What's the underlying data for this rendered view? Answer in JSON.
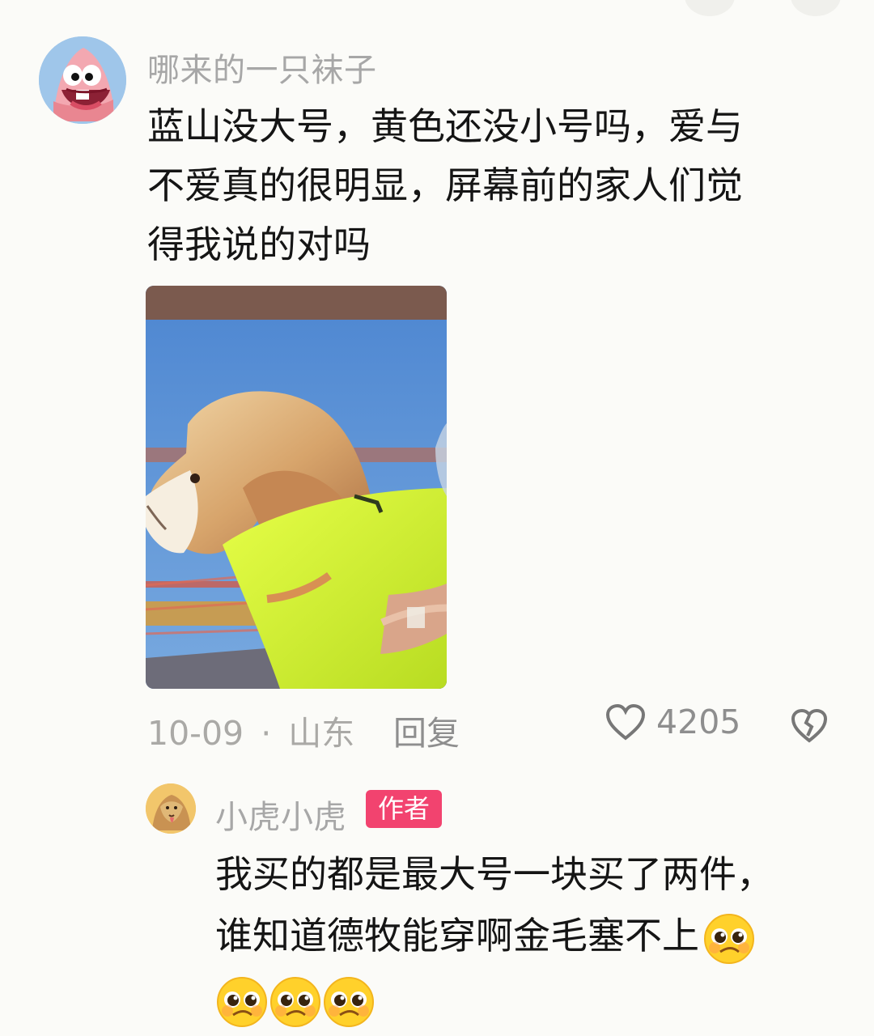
{
  "comment": {
    "username": "哪来的一只袜子",
    "text_lines": [
      "蓝山没大号，黄色还没小号吗，爱与",
      "不爱真的很明显，屏幕前的家人们觉",
      "得我说的对吗"
    ],
    "date": "10-09",
    "separator": "·",
    "location": "山东",
    "reply_label": "回复",
    "likes": "4205"
  },
  "reply": {
    "username": "小虎小虎",
    "badge": "作者",
    "text_lines": [
      "我买的都是最大号一块买了两件，",
      "谁知道德牧能穿啊金毛塞不上"
    ],
    "emoji": [
      "pleading-face-icon",
      "pleading-face-icon",
      "pleading-face-icon",
      "pleading-face-icon"
    ]
  },
  "colors": {
    "background": "#fbfbf8",
    "muted": "#a7a7a7",
    "badge": "#f2436f"
  }
}
